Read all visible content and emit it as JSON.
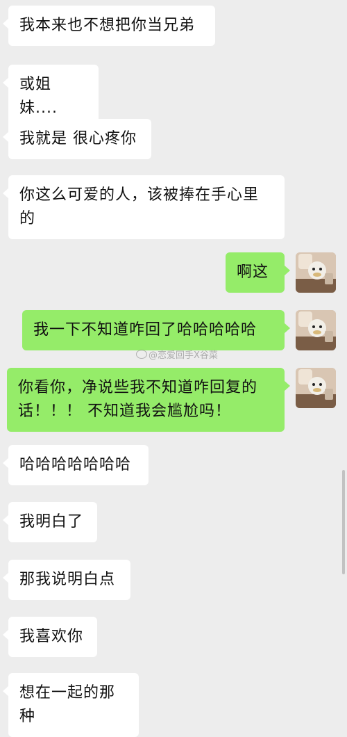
{
  "messages": [
    {
      "text": "我本来也不想把你当兄弟"
    },
    {
      "text": "或姐妹...."
    },
    {
      "text": "我就是 很心疼你"
    },
    {
      "text": "你这么可爱的人，该被捧在手心里的"
    },
    {
      "text": "啊这"
    },
    {
      "text": "我一下不知道咋回了哈哈哈哈哈"
    },
    {
      "text": "你看你，净说些我不知道咋回复的话！！！ 不知道我会尴尬吗！"
    },
    {
      "text": "哈哈哈哈哈哈哈"
    },
    {
      "text": "我明白了"
    },
    {
      "text": "那我说明白点"
    },
    {
      "text": "我喜欢你"
    },
    {
      "text": "想在一起的那种"
    }
  ],
  "watermark": "@恋爱回手X谷菜",
  "colors": {
    "background": "#ededed",
    "incoming_bubble": "#ffffff",
    "outgoing_bubble": "#95ec69",
    "text": "#111111"
  },
  "icons": {
    "avatar": "user-avatar-photo",
    "watermark": "weibo-icon"
  }
}
